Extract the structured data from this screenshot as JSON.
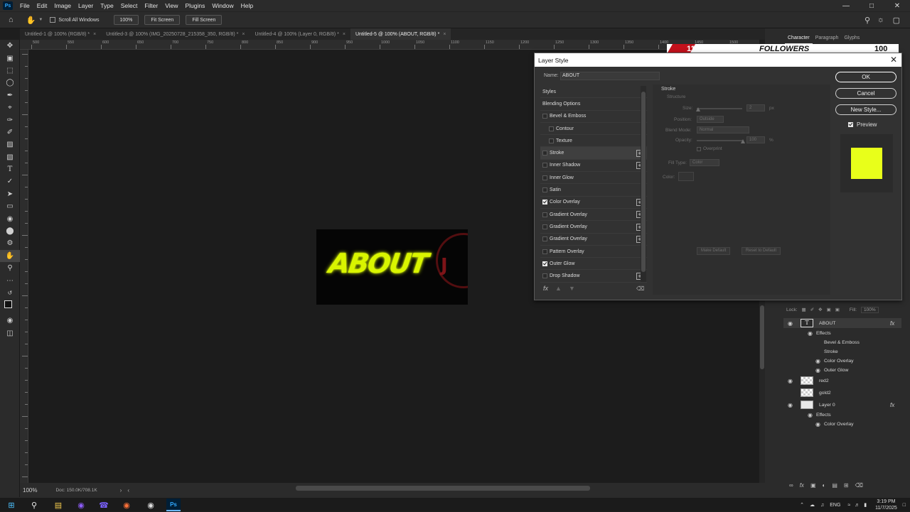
{
  "menubar": {
    "app_icon": "Ps",
    "items": [
      "File",
      "Edit",
      "Image",
      "Layer",
      "Type",
      "Select",
      "Filter",
      "View",
      "Plugins",
      "Window",
      "Help"
    ]
  },
  "options": {
    "scroll_all_label": "Scroll All Windows",
    "zoom_btn": "100%",
    "fit_screen_btn": "Fit Screen",
    "fill_screen_btn": "Fill Screen"
  },
  "tabs": [
    {
      "label": "Untitled-1 @ 100% (RGB/8) *"
    },
    {
      "label": "Untitled-3 @ 100% (IMG_20250728_215358_350, RGB/8) *"
    },
    {
      "label": "Untitled-4 @ 100% (Layer 0, RGB/8) *"
    },
    {
      "label": "Untitled-5 @ 100% (ABOUT, RGB/8) *"
    }
  ],
  "ruler_ticks": [
    "500",
    "550",
    "600",
    "650",
    "700",
    "750",
    "800",
    "850",
    "900",
    "950",
    "1000",
    "1050",
    "1100",
    "1150",
    "1200",
    "1250",
    "1300",
    "1350",
    "1400",
    "1450",
    "1500"
  ],
  "artwork": {
    "main_text": "ABOUT",
    "logo_letter": "J",
    "text_color": "#d9f500"
  },
  "right_panel": {
    "tabs": [
      "Character",
      "Paragraph",
      "Glyphs"
    ],
    "banner_left": "11",
    "banner_mid": "FOLLOWERS",
    "banner_right": "100"
  },
  "layer_style": {
    "title": "Layer Style",
    "name_label": "Name:",
    "name_value": "ABOUT",
    "styles": [
      {
        "label": "Styles",
        "kind": "header"
      },
      {
        "label": "Blending Options",
        "kind": "header"
      },
      {
        "label": "Bevel & Emboss",
        "checked": false,
        "plus": false
      },
      {
        "label": "Contour",
        "checked": false,
        "plus": false,
        "sub": true
      },
      {
        "label": "Texture",
        "checked": false,
        "plus": false,
        "sub": true
      },
      {
        "label": "Stroke",
        "checked": false,
        "plus": true,
        "selected": true
      },
      {
        "label": "Inner Shadow",
        "checked": false,
        "plus": true
      },
      {
        "label": "Inner Glow",
        "checked": false,
        "plus": false
      },
      {
        "label": "Satin",
        "checked": false,
        "plus": false
      },
      {
        "label": "Color Overlay",
        "checked": true,
        "plus": true
      },
      {
        "label": "Gradient Overlay",
        "checked": false,
        "plus": true
      },
      {
        "label": "Gradient Overlay",
        "checked": false,
        "plus": true
      },
      {
        "label": "Gradient Overlay",
        "checked": false,
        "plus": true
      },
      {
        "label": "Pattern Overlay",
        "checked": false,
        "plus": false
      },
      {
        "label": "Outer Glow",
        "checked": true,
        "plus": false
      },
      {
        "label": "Drop Shadow",
        "checked": false,
        "plus": true
      }
    ],
    "stroke": {
      "title": "Stroke",
      "structure": "Structure",
      "size_label": "Size:",
      "size_value": "2",
      "size_unit": "px",
      "position_label": "Position:",
      "position_value": "Outside",
      "blend_label": "Blend Mode:",
      "blend_value": "Normal",
      "opacity_label": "Opacity:",
      "opacity_value": "100",
      "opacity_unit": "%",
      "overprint": "Overprint",
      "fill_type_label": "Fill Type:",
      "fill_type_value": "Color",
      "color_label": "Color:",
      "make_default": "Make Default",
      "reset_default": "Reset to Default"
    },
    "buttons": {
      "ok": "OK",
      "cancel": "Cancel",
      "new_style": "New Style...",
      "preview": "Preview"
    },
    "preview_color": "#e8ff1a"
  },
  "layers": {
    "lock_label": "Lock:",
    "fill_label": "Fill:",
    "fill_value": "100%",
    "rows": [
      {
        "name": "ABOUT",
        "type": "text",
        "eye": true,
        "fx": true
      },
      {
        "name": "Effects",
        "type": "effects-header"
      },
      {
        "name": "Bevel & Emboss",
        "type": "effect",
        "eye": false
      },
      {
        "name": "Stroke",
        "type": "effect",
        "eye": false
      },
      {
        "name": "Color Overlay",
        "type": "effect",
        "eye": true
      },
      {
        "name": "Outer Glow",
        "type": "effect",
        "eye": true
      },
      {
        "name": "red2",
        "type": "smart",
        "eye": true
      },
      {
        "name": "gold2",
        "type": "smart",
        "eye": false
      },
      {
        "name": "Layer 0",
        "type": "white",
        "eye": true,
        "fx": true
      },
      {
        "name": "Effects",
        "type": "effects-header"
      },
      {
        "name": "Color Overlay",
        "type": "effect",
        "eye": true
      }
    ]
  },
  "status": {
    "zoom": "100%",
    "doc": "Doc: 150.0K/708.1K"
  },
  "taskbar": {
    "lang": "ENG",
    "time": "3:19 PM",
    "date": "11/7/2025"
  }
}
